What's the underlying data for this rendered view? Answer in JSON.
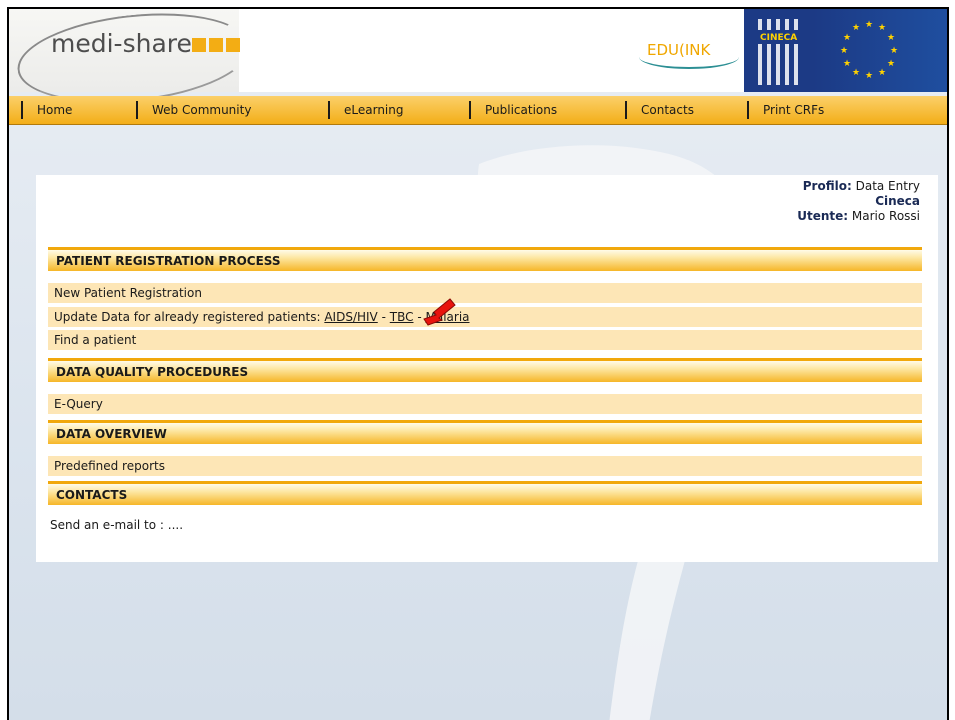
{
  "header": {
    "logo_text": "medi-share",
    "edulink_text": "EDU(INK",
    "cineca_label": "CINECA"
  },
  "nav": {
    "items": [
      {
        "label": "Home"
      },
      {
        "label": "Web Community"
      },
      {
        "label": "eLearning"
      },
      {
        "label": "Publications"
      },
      {
        "label": "Contacts"
      },
      {
        "label": "Print CRFs"
      }
    ]
  },
  "profile": {
    "profile_label": "Profilo:",
    "profile_value": "Data Entry",
    "org": "Cineca",
    "user_label": "Utente:",
    "user_value": "Mario Rossi"
  },
  "sections": {
    "registration": {
      "title": "PATIENT REGISTRATION PROCESS",
      "new_patient": "New Patient Registration",
      "update_text": "Update Data for already registered patients:",
      "link_aids": "AIDS/HIV",
      "link_tbc": "TBC",
      "separator": "-",
      "link_malaria": "Malaria",
      "find_patient": "Find a patient"
    },
    "quality": {
      "title": "DATA QUALITY PROCEDURES",
      "equery": "E-Query"
    },
    "overview": {
      "title": "DATA OVERVIEW",
      "reports": "Predefined reports"
    },
    "contacts": {
      "title": "CONTACTS",
      "email_text": "Send an e-mail to : ...."
    }
  },
  "colors": {
    "accent_orange": "#f3ae18",
    "row_fill": "#fde6b6",
    "eu_blue": "#1c3a85",
    "arrow_red": "#e8130d"
  },
  "icons": {
    "annotation_arrow": "red-arrow-icon"
  }
}
